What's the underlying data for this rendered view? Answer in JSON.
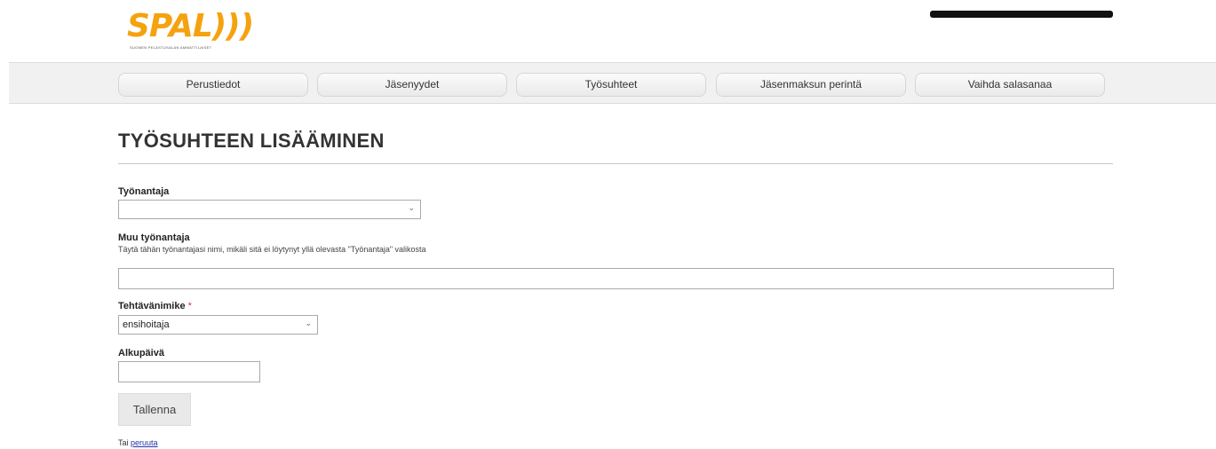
{
  "logo": {
    "text": "SPAL)))",
    "tagline": "SUOMEN PELASTUSALAN AMMATTILAISET",
    "color": "#f5a20f"
  },
  "nav": {
    "items": [
      {
        "label": "Perustiedot"
      },
      {
        "label": "Jäsenyydet"
      },
      {
        "label": "Työsuhteet"
      },
      {
        "label": "Jäsenmaksun perintä"
      },
      {
        "label": "Vaihda salasanaa"
      }
    ]
  },
  "page": {
    "title": "TYÖSUHTEEN LISÄÄMINEN"
  },
  "form": {
    "employer": {
      "label": "Työnantaja",
      "value": "",
      "chevron": "chevron-down-icon"
    },
    "other_employer": {
      "label": "Muu työnantaja",
      "help": "Täytä tähän työnantajasi nimi, mikäli sitä ei löytynyt yllä olevasta \"Työnantaja\" valikosta",
      "value": ""
    },
    "job_title": {
      "label": "Tehtävänimike",
      "required_mark": "*",
      "value": "ensihoitaja",
      "chevron": "chevron-down-icon"
    },
    "start_date": {
      "label": "Alkupäivä",
      "value": ""
    },
    "save_label": "Tallenna",
    "cancel_prefix": "Tai",
    "cancel_link": "peruuta"
  },
  "colors": {
    "required": "#dd3333",
    "link": "#2233aa"
  }
}
